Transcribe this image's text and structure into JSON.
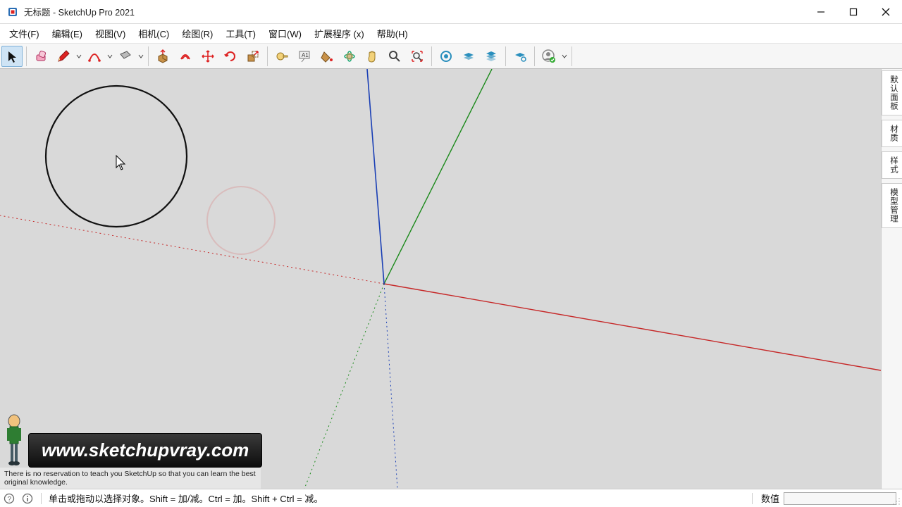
{
  "title": "无标题 - SketchUp Pro 2021",
  "menu": {
    "file": "文件(F)",
    "edit": "编辑(E)",
    "view": "视图(V)",
    "camera": "相机(C)",
    "draw": "绘图(R)",
    "tools": "工具(T)",
    "window": "窗口(W)",
    "ext": "扩展程序 (x)",
    "help": "帮助(H)"
  },
  "right_panels": {
    "p0": "默认面板",
    "p1": "材质",
    "p2": "样式",
    "p3": "模型管理"
  },
  "toolbar_icons": {
    "select": "select-tool",
    "eraser": "eraser-tool",
    "pencil": "line-tool",
    "arc": "arc-tool",
    "rect": "rectangle-tool",
    "pushpull": "pushpull-tool",
    "offset": "offset-tool",
    "move": "move-tool",
    "rotate": "rotate-tool",
    "scale": "scale-tool",
    "tape": "tape-measure-tool",
    "text": "text-tool",
    "paint": "paint-bucket-tool",
    "orbit": "orbit-tool",
    "pan": "pan-tool",
    "zoom": "zoom-tool",
    "zoomext": "zoom-extents-tool",
    "vray1": "vray-asset-icon",
    "vray2": "vray-frame-icon",
    "vray3": "vray-render-icon",
    "vray4": "vray-settings-icon",
    "user": "user-account-icon"
  },
  "status": {
    "hint": "单击或拖动以选择对象。Shift = 加/减。Ctrl = 加。Shift + Ctrl = 减。",
    "label": "数值",
    "value": ""
  },
  "watermark": {
    "url": "www.sketchupvray.com",
    "sub": "There is no reservation to teach you SketchUp so that you can learn the best original knowledge."
  }
}
